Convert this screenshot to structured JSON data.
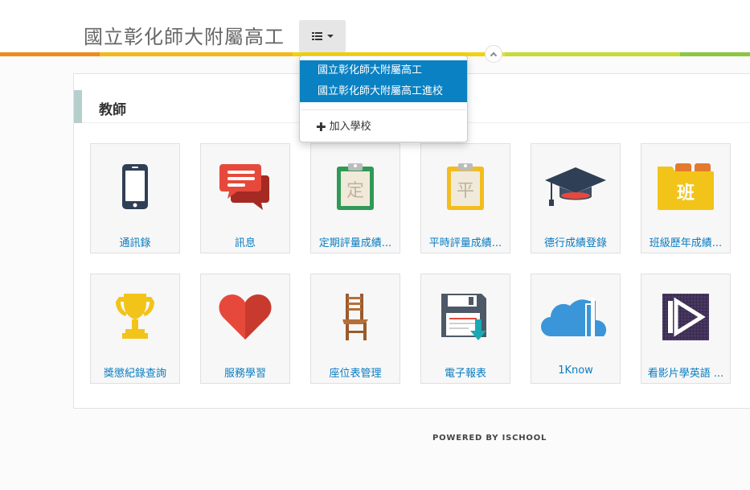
{
  "header": {
    "school_name": "國立彰化師大附屬高工"
  },
  "color_bar": [
    "#f08a1c",
    "#f4b81b",
    "#f1d20f",
    "#e7e02a",
    "#c6db3a",
    "#8cc63f"
  ],
  "dropdown": {
    "items": [
      {
        "label": "國立彰化師大附屬高工"
      },
      {
        "label": "國立彰化師大附屬高工進校"
      }
    ],
    "add_label": "加入學校"
  },
  "panel": {
    "title": "教師"
  },
  "tiles": [
    {
      "label": "通訊錄",
      "icon": "phone-icon"
    },
    {
      "label": "訊息",
      "icon": "chat-icon"
    },
    {
      "label": "定期評量成績...",
      "icon": "clipboard-ding-icon"
    },
    {
      "label": "平時評量成績...",
      "icon": "clipboard-ping-icon"
    },
    {
      "label": "德行成績登錄",
      "icon": "graduation-cap-icon"
    },
    {
      "label": "班級歷年成績...",
      "icon": "class-folder-icon"
    },
    {
      "label": "獎懲紀錄查詢",
      "icon": "trophy-icon"
    },
    {
      "label": "服務學習",
      "icon": "heart-icon"
    },
    {
      "label": "座位表管理",
      "icon": "chair-icon"
    },
    {
      "label": "電子報表",
      "icon": "floppy-download-icon"
    },
    {
      "label": "1Know",
      "icon": "cloud-icon"
    },
    {
      "label": "看影片學英語 ...",
      "icon": "video-play-icon"
    }
  ],
  "icon_text": {
    "ding": "定",
    "ping": "平",
    "ban": "班"
  },
  "footer": {
    "text": "POWERED BY ISCHOOL"
  }
}
